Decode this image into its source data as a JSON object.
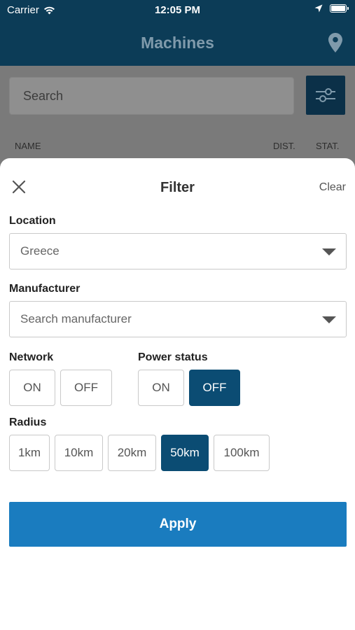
{
  "status_bar": {
    "carrier": "Carrier",
    "time": "12:05 PM"
  },
  "nav": {
    "title": "Machines"
  },
  "background": {
    "search_placeholder": "Search",
    "columns": [
      "NAME",
      "DIST.",
      "STAT."
    ]
  },
  "filter": {
    "title": "Filter",
    "clear": "Clear",
    "location": {
      "label": "Location",
      "value": "Greece"
    },
    "manufacturer": {
      "label": "Manufacturer",
      "placeholder": "Search manufacturer"
    },
    "network": {
      "label": "Network",
      "options": [
        "ON",
        "OFF"
      ]
    },
    "power_status": {
      "label": "Power status",
      "options": [
        "ON",
        "OFF"
      ],
      "selected": "OFF"
    },
    "radius": {
      "label": "Radius",
      "options": [
        "1km",
        "10km",
        "20km",
        "50km",
        "100km"
      ],
      "selected": "50km"
    },
    "apply": "Apply"
  },
  "colors": {
    "header_bg": "#0c3c57",
    "selected_chip": "#0b4c73",
    "apply_button": "#1a7cbf"
  }
}
